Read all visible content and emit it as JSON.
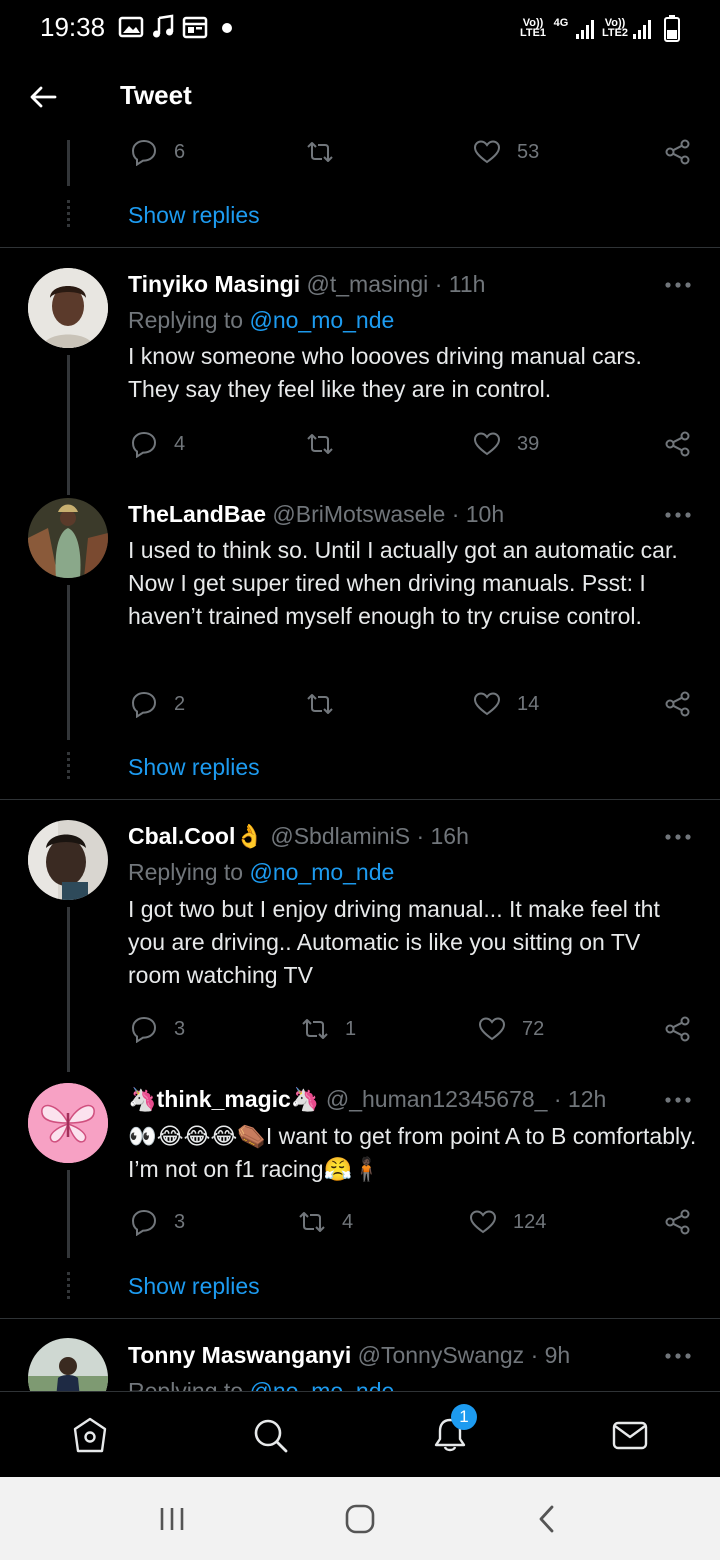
{
  "status_bar": {
    "time": "19:38",
    "sim1": "Vo)) LTE1",
    "net1": "4G",
    "sim2": "Vo)) LTE2"
  },
  "header": {
    "title": "Tweet"
  },
  "top_actions": {
    "replies": "6",
    "retweets": "",
    "likes": "53"
  },
  "top_show_replies": "Show replies",
  "tweets": [
    {
      "name": "Tinyiko Masingi",
      "handle": "@t_masingi",
      "time": "· 11h",
      "replying_prefix": "Replying to ",
      "replying_to": "@no_mo_nde",
      "text": "I know someone who loooves driving manual cars. They say they feel like they are in control.",
      "replies": "4",
      "retweets": "",
      "likes": "39"
    },
    {
      "name": "TheLandBae",
      "handle": "@BriMotswasele",
      "time": "· 10h",
      "text": "I used to think so. Until I actually got an automatic car. Now I get super tired when driving manuals. Psst: I haven’t trained myself enough to try cruise control.",
      "replies": "2",
      "retweets": "",
      "likes": "14",
      "show_replies": "Show replies"
    },
    {
      "name": "Cbal.Cool👌",
      "handle": "@SbdlaminiS",
      "time": "· 16h",
      "replying_prefix": "Replying to ",
      "replying_to": "@no_mo_nde",
      "text": "I got two but I enjoy driving manual... It make feel tht you are driving.. Automatic is like you sitting on TV room watching TV",
      "replies": "3",
      "retweets": "1",
      "likes": "72"
    },
    {
      "name": "🦄think_magic🦄",
      "handle": "@_human12345678_",
      "time": "· 12h",
      "text": "👀😂😂😂⚰️I want to get from point A to B comfortably. I’m not on f1 racing😤🧍🏿",
      "replies": "3",
      "retweets": "4",
      "likes": "124",
      "show_replies": "Show replies"
    },
    {
      "name": "Tonny Maswanganyi",
      "handle": "@TonnySwangz",
      "time": "· 9h",
      "replying_prefix": "Replying to ",
      "replying_to": "@no_mo_nde"
    }
  ],
  "bottom_nav": {
    "items": [
      "home",
      "search",
      "notifications",
      "messages"
    ],
    "notification_count": "1"
  },
  "colors": {
    "background": "#000000",
    "accent": "#1d9bf0",
    "muted": "#71767b",
    "text": "#e7e9ea"
  }
}
